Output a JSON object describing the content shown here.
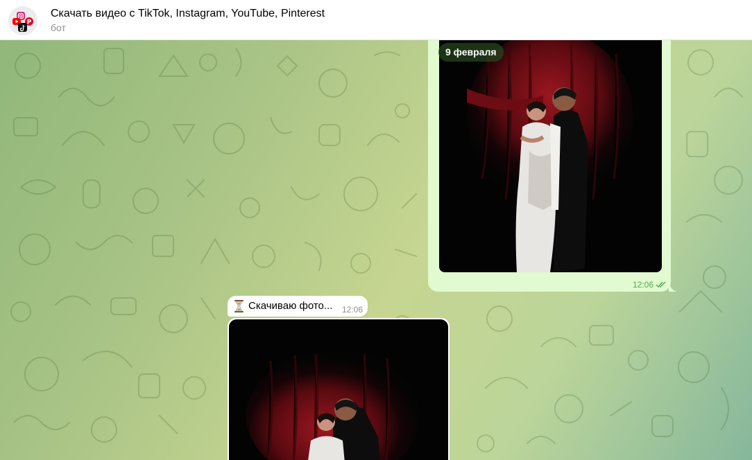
{
  "header": {
    "title": "Скачать видео с TikTok, Instagram, YouTube, Pinterest",
    "subtitle": "бот",
    "avatar_icon": "bot-avatar-icon"
  },
  "messages": [
    {
      "direction": "outgoing",
      "type": "photo",
      "date_badge": "9 февраля",
      "time": "12:06",
      "status": "read",
      "status_icon": "double-check-icon"
    },
    {
      "direction": "incoming",
      "type": "text",
      "icon": "hourglass-icon",
      "text": "Скачиваю фото...",
      "time": "12:06"
    },
    {
      "direction": "incoming",
      "type": "photo"
    }
  ],
  "colors": {
    "outgoing_bubble": "#e1fad0",
    "incoming_bubble": "#ffffff",
    "time_outgoing": "#5aa85a",
    "curtain_red": "#7d0d14"
  }
}
